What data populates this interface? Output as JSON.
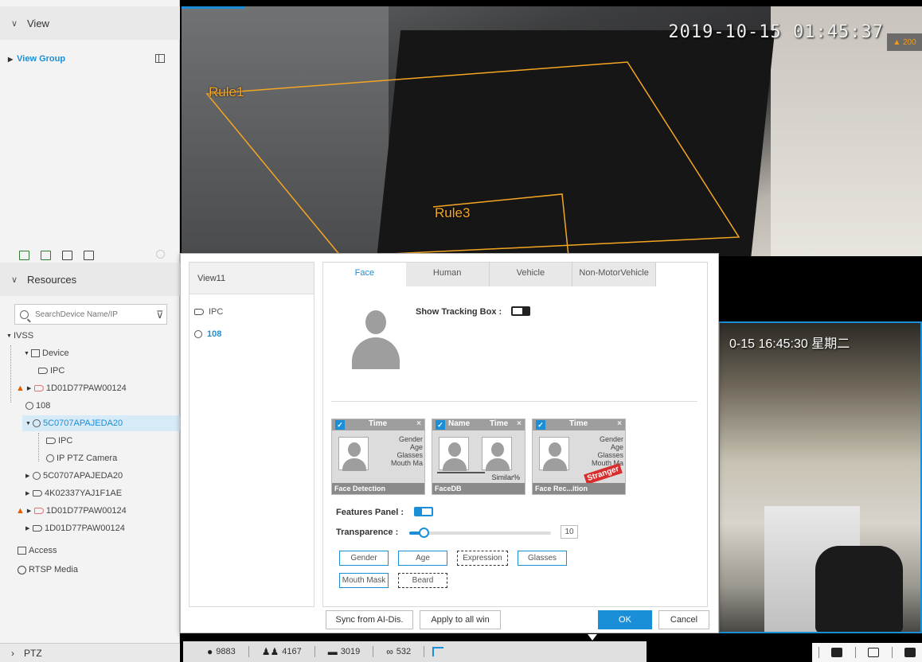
{
  "sidebar": {
    "view_section": "View",
    "view_group": "View Group",
    "resources_section": "Resources",
    "search_placeholder": "SearchDevice Name/IP",
    "tree": {
      "root": "IVSS",
      "device": "Device",
      "n1": "IPC",
      "n2": "1D01D77PAW00124",
      "n3": "108",
      "n4": "5C0707APAJEDA20",
      "n4a": "IPC",
      "n4b": "IP PTZ Camera",
      "n5": "5C0707APAJEDA20",
      "n6": "4K02337YAJ1F1AE",
      "n7": "1D01D77PAW00124",
      "n8": "1D01D77PAW00124",
      "access": "Access",
      "rtsp": "RTSP Media"
    },
    "ptz": "PTZ"
  },
  "video": {
    "timestamp_top": "2019-10-15 01:45:37",
    "alarm_count": "200",
    "rule1": "Rule1",
    "rule3": "Rule3",
    "timestamp_right": "0-15 16:45:30 星期二"
  },
  "dialog": {
    "window_name": "View11",
    "channels": [
      "IPC",
      "108"
    ],
    "tabs": [
      "Face",
      "Human",
      "Vehicle",
      "Non-MotorVehicle"
    ],
    "show_tracking_box": "Show Tracking Box :",
    "cards": [
      {
        "time": "Time",
        "attrs": [
          "Gender",
          "Age",
          "Glasses",
          "Mouth Ma"
        ],
        "footer": "Face Detection"
      },
      {
        "name": "Name",
        "time": "Time",
        "similar": "Similar%",
        "footer": "FaceDB"
      },
      {
        "time": "Time",
        "attrs": [
          "Gender",
          "Age",
          "Glasses",
          "Mouth Ma"
        ],
        "footer": "Face Rec...ition",
        "badge": "Stranger"
      }
    ],
    "features_panel": "Features Panel :",
    "transparence": "Transparence :",
    "transparence_value": "10",
    "transparence_percent": 10,
    "attr_buttons": [
      "Gender",
      "Age",
      "Expression",
      "Glasses",
      "Mouth Mask",
      "Beard"
    ],
    "sync_btn": "Sync from AI-Dis.",
    "apply_btn": "Apply to all win",
    "ok": "OK",
    "cancel": "Cancel"
  },
  "stats": {
    "people": "9883",
    "group": "4167",
    "car": "3019",
    "bike": "532"
  },
  "colors": {
    "accent": "#1a8fd8",
    "rule": "#f5a623",
    "warn": "#e55d00"
  }
}
